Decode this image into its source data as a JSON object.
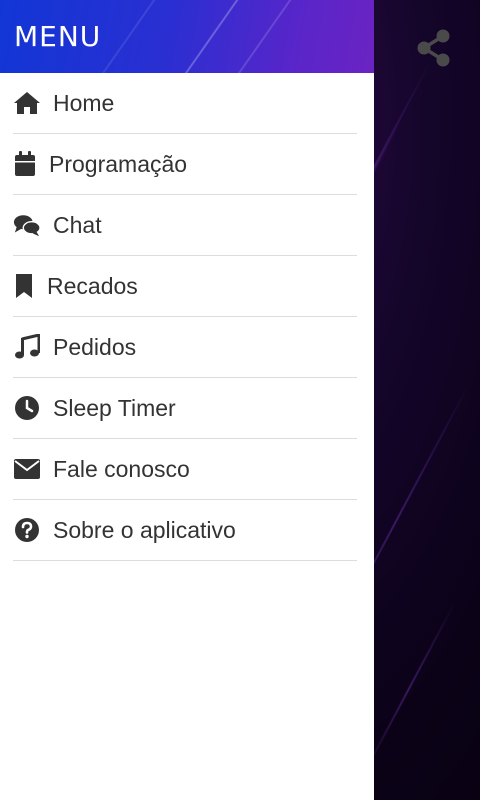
{
  "drawer": {
    "title": "MENU",
    "items": [
      {
        "label": "Home",
        "icon": "home-icon"
      },
      {
        "label": "Programação",
        "icon": "calendar-icon"
      },
      {
        "label": "Chat",
        "icon": "chat-bubbles-icon"
      },
      {
        "label": "Recados",
        "icon": "bookmark-icon"
      },
      {
        "label": "Pedidos",
        "icon": "music-note-icon"
      },
      {
        "label": "Sleep Timer",
        "icon": "clock-icon"
      },
      {
        "label": "Fale conosco",
        "icon": "envelope-icon"
      },
      {
        "label": "Sobre o aplicativo",
        "icon": "question-circle-icon"
      }
    ]
  },
  "app": {
    "share_icon": "share-icon"
  },
  "colors": {
    "header_start": "#1236d6",
    "header_end": "#6b24c2",
    "text": "#333333",
    "divider": "#dcdcdc",
    "background_dark": "#0b0217"
  }
}
